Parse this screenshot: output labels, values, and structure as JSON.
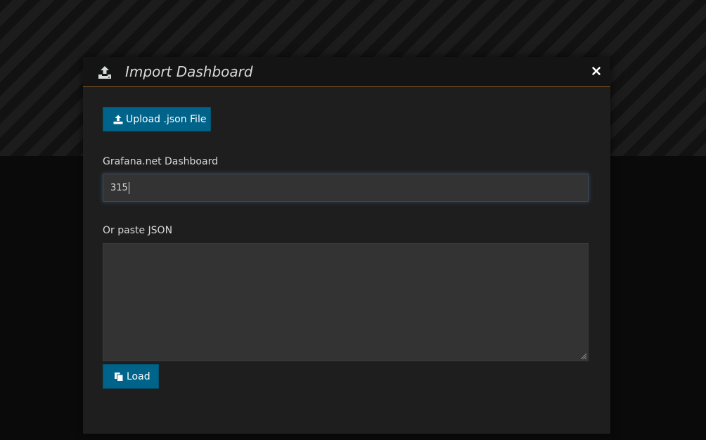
{
  "modal": {
    "title": "Import Dashboard",
    "header_icon": "upload-icon",
    "close_icon": "close-icon"
  },
  "upload": {
    "label": "Upload .json File",
    "icon": "upload-icon"
  },
  "grafana_net": {
    "label": "Grafana.net Dashboard",
    "value": "315"
  },
  "paste_json": {
    "label": "Or paste JSON",
    "value": ""
  },
  "load": {
    "label": "Load",
    "icon": "copy-icon"
  },
  "colors": {
    "primary_button": "#00638a",
    "header_border": "#8a5a2a",
    "modal_bg": "#1f1e1f",
    "input_bg": "#333333"
  }
}
